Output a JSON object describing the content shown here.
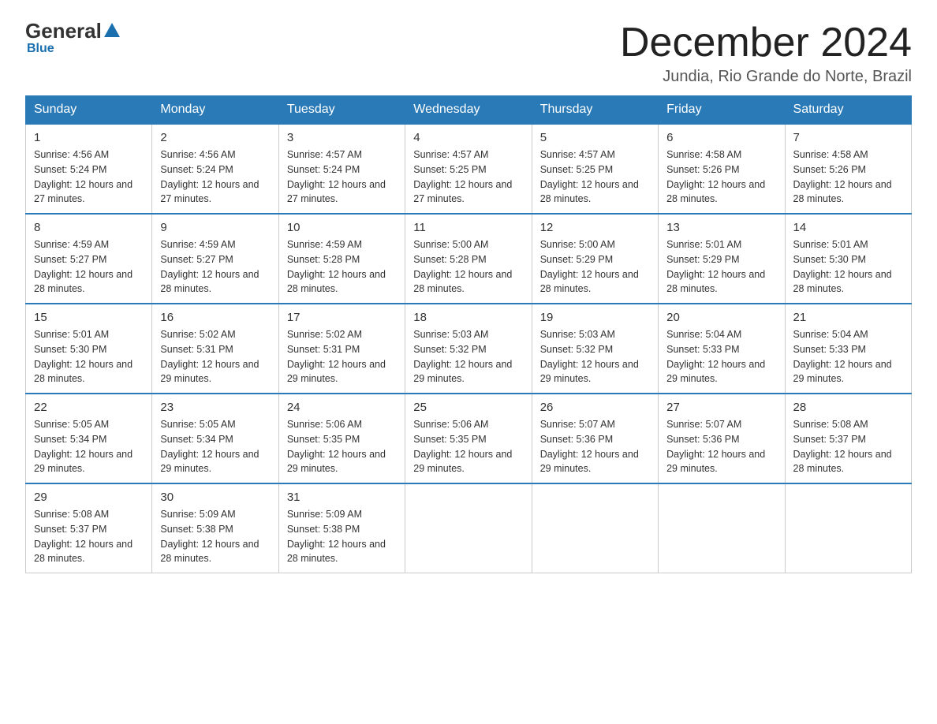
{
  "logo": {
    "general": "General",
    "blue_text": "Blue",
    "subtitle": "Blue"
  },
  "title": {
    "month_year": "December 2024",
    "location": "Jundia, Rio Grande do Norte, Brazil"
  },
  "weekdays": [
    "Sunday",
    "Monday",
    "Tuesday",
    "Wednesday",
    "Thursday",
    "Friday",
    "Saturday"
  ],
  "weeks": [
    [
      {
        "day": "1",
        "sunrise": "4:56 AM",
        "sunset": "5:24 PM",
        "daylight": "12 hours and 27 minutes."
      },
      {
        "day": "2",
        "sunrise": "4:56 AM",
        "sunset": "5:24 PM",
        "daylight": "12 hours and 27 minutes."
      },
      {
        "day": "3",
        "sunrise": "4:57 AM",
        "sunset": "5:24 PM",
        "daylight": "12 hours and 27 minutes."
      },
      {
        "day": "4",
        "sunrise": "4:57 AM",
        "sunset": "5:25 PM",
        "daylight": "12 hours and 27 minutes."
      },
      {
        "day": "5",
        "sunrise": "4:57 AM",
        "sunset": "5:25 PM",
        "daylight": "12 hours and 28 minutes."
      },
      {
        "day": "6",
        "sunrise": "4:58 AM",
        "sunset": "5:26 PM",
        "daylight": "12 hours and 28 minutes."
      },
      {
        "day": "7",
        "sunrise": "4:58 AM",
        "sunset": "5:26 PM",
        "daylight": "12 hours and 28 minutes."
      }
    ],
    [
      {
        "day": "8",
        "sunrise": "4:59 AM",
        "sunset": "5:27 PM",
        "daylight": "12 hours and 28 minutes."
      },
      {
        "day": "9",
        "sunrise": "4:59 AM",
        "sunset": "5:27 PM",
        "daylight": "12 hours and 28 minutes."
      },
      {
        "day": "10",
        "sunrise": "4:59 AM",
        "sunset": "5:28 PM",
        "daylight": "12 hours and 28 minutes."
      },
      {
        "day": "11",
        "sunrise": "5:00 AM",
        "sunset": "5:28 PM",
        "daylight": "12 hours and 28 minutes."
      },
      {
        "day": "12",
        "sunrise": "5:00 AM",
        "sunset": "5:29 PM",
        "daylight": "12 hours and 28 minutes."
      },
      {
        "day": "13",
        "sunrise": "5:01 AM",
        "sunset": "5:29 PM",
        "daylight": "12 hours and 28 minutes."
      },
      {
        "day": "14",
        "sunrise": "5:01 AM",
        "sunset": "5:30 PM",
        "daylight": "12 hours and 28 minutes."
      }
    ],
    [
      {
        "day": "15",
        "sunrise": "5:01 AM",
        "sunset": "5:30 PM",
        "daylight": "12 hours and 28 minutes."
      },
      {
        "day": "16",
        "sunrise": "5:02 AM",
        "sunset": "5:31 PM",
        "daylight": "12 hours and 29 minutes."
      },
      {
        "day": "17",
        "sunrise": "5:02 AM",
        "sunset": "5:31 PM",
        "daylight": "12 hours and 29 minutes."
      },
      {
        "day": "18",
        "sunrise": "5:03 AM",
        "sunset": "5:32 PM",
        "daylight": "12 hours and 29 minutes."
      },
      {
        "day": "19",
        "sunrise": "5:03 AM",
        "sunset": "5:32 PM",
        "daylight": "12 hours and 29 minutes."
      },
      {
        "day": "20",
        "sunrise": "5:04 AM",
        "sunset": "5:33 PM",
        "daylight": "12 hours and 29 minutes."
      },
      {
        "day": "21",
        "sunrise": "5:04 AM",
        "sunset": "5:33 PM",
        "daylight": "12 hours and 29 minutes."
      }
    ],
    [
      {
        "day": "22",
        "sunrise": "5:05 AM",
        "sunset": "5:34 PM",
        "daylight": "12 hours and 29 minutes."
      },
      {
        "day": "23",
        "sunrise": "5:05 AM",
        "sunset": "5:34 PM",
        "daylight": "12 hours and 29 minutes."
      },
      {
        "day": "24",
        "sunrise": "5:06 AM",
        "sunset": "5:35 PM",
        "daylight": "12 hours and 29 minutes."
      },
      {
        "day": "25",
        "sunrise": "5:06 AM",
        "sunset": "5:35 PM",
        "daylight": "12 hours and 29 minutes."
      },
      {
        "day": "26",
        "sunrise": "5:07 AM",
        "sunset": "5:36 PM",
        "daylight": "12 hours and 29 minutes."
      },
      {
        "day": "27",
        "sunrise": "5:07 AM",
        "sunset": "5:36 PM",
        "daylight": "12 hours and 29 minutes."
      },
      {
        "day": "28",
        "sunrise": "5:08 AM",
        "sunset": "5:37 PM",
        "daylight": "12 hours and 28 minutes."
      }
    ],
    [
      {
        "day": "29",
        "sunrise": "5:08 AM",
        "sunset": "5:37 PM",
        "daylight": "12 hours and 28 minutes."
      },
      {
        "day": "30",
        "sunrise": "5:09 AM",
        "sunset": "5:38 PM",
        "daylight": "12 hours and 28 minutes."
      },
      {
        "day": "31",
        "sunrise": "5:09 AM",
        "sunset": "5:38 PM",
        "daylight": "12 hours and 28 minutes."
      },
      null,
      null,
      null,
      null
    ]
  ]
}
